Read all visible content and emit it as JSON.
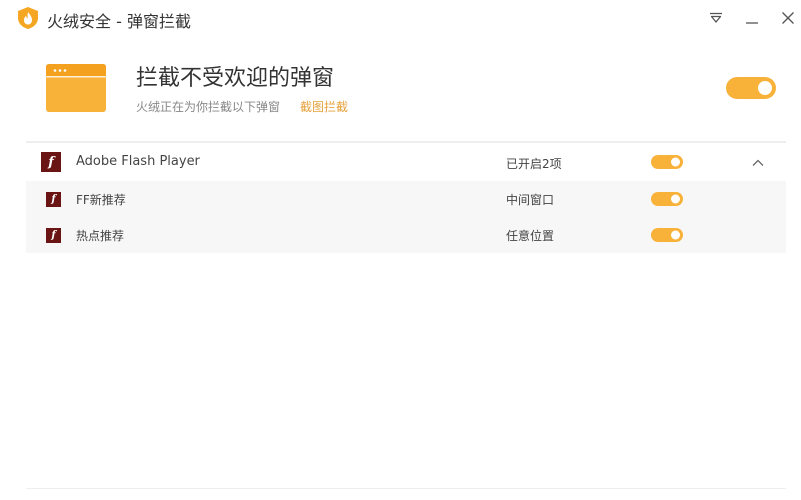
{
  "window": {
    "title": "火绒安全 - 弹窗拦截",
    "logo_icon": "flame-shield-icon",
    "controls": [
      "dropdown-menu-icon",
      "minimize-icon",
      "close-icon"
    ]
  },
  "hero": {
    "icon": "browser-window-icon",
    "title": "拦截不受欢迎的弹窗",
    "subtitle": "火绒正在为你拦截以下弹窗",
    "link": "截图拦截",
    "enabled": true
  },
  "list": {
    "group": {
      "name": "Adobe Flash Player",
      "status": "已开启2项",
      "enabled": true,
      "expanded": true,
      "icon": "flash-icon",
      "icon_glyph": "f"
    },
    "items": [
      {
        "name": "FF新推荐",
        "status": "中间窗口",
        "enabled": true,
        "icon": "flash-icon",
        "icon_glyph": "f"
      },
      {
        "name": "热点推荐",
        "status": "任意位置",
        "enabled": true,
        "icon": "flash-icon",
        "icon_glyph": "f"
      }
    ]
  },
  "colors": {
    "accent": "#f8b23a",
    "link": "#e6a23c",
    "flash_icon_bg": "#6a1414",
    "sub_row_bg": "#f7f7f7"
  }
}
